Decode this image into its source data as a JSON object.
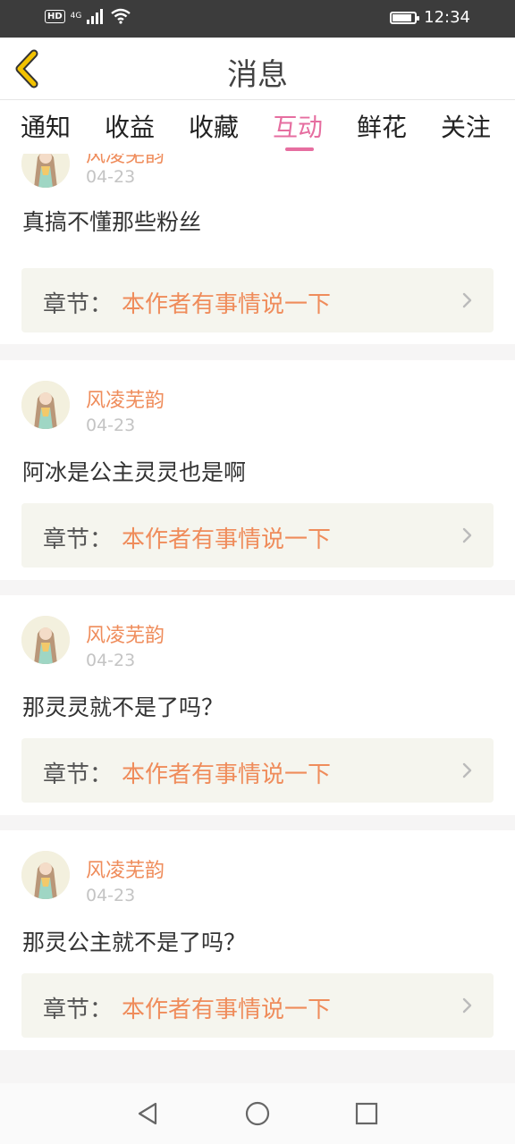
{
  "status_bar": {
    "hd": "HD",
    "network": "4G",
    "time": "12:34",
    "battery_level": 0.85
  },
  "header": {
    "title": "消息"
  },
  "tabs": [
    {
      "label": "通知",
      "active": false
    },
    {
      "label": "收益",
      "active": false
    },
    {
      "label": "收藏",
      "active": false
    },
    {
      "label": "互动",
      "active": true
    },
    {
      "label": "鲜花",
      "active": false
    },
    {
      "label": "关注",
      "active": false
    }
  ],
  "messages": [
    {
      "author": "风凌芜韵",
      "date": "04-23",
      "comment": "真搞不懂那些粉丝",
      "chapter_label": "章节：",
      "chapter_title": "本作者有事情说一下"
    },
    {
      "author": "风凌芜韵",
      "date": "04-23",
      "comment": "阿冰是公主灵灵也是啊",
      "chapter_label": "章节：",
      "chapter_title": "本作者有事情说一下"
    },
    {
      "author": "风凌芜韵",
      "date": "04-23",
      "comment": "那灵灵就不是了吗？",
      "chapter_label": "章节：",
      "chapter_title": "本作者有事情说一下"
    },
    {
      "author": "风凌芜韵",
      "date": "04-23",
      "comment": "那灵公主就不是了吗？",
      "chapter_label": "章节：",
      "chapter_title": "本作者有事情说一下"
    }
  ],
  "colors": {
    "accent_pink": "#e66ea0",
    "accent_orange": "#ef8c5b",
    "back_arrow": "#f2c200"
  }
}
